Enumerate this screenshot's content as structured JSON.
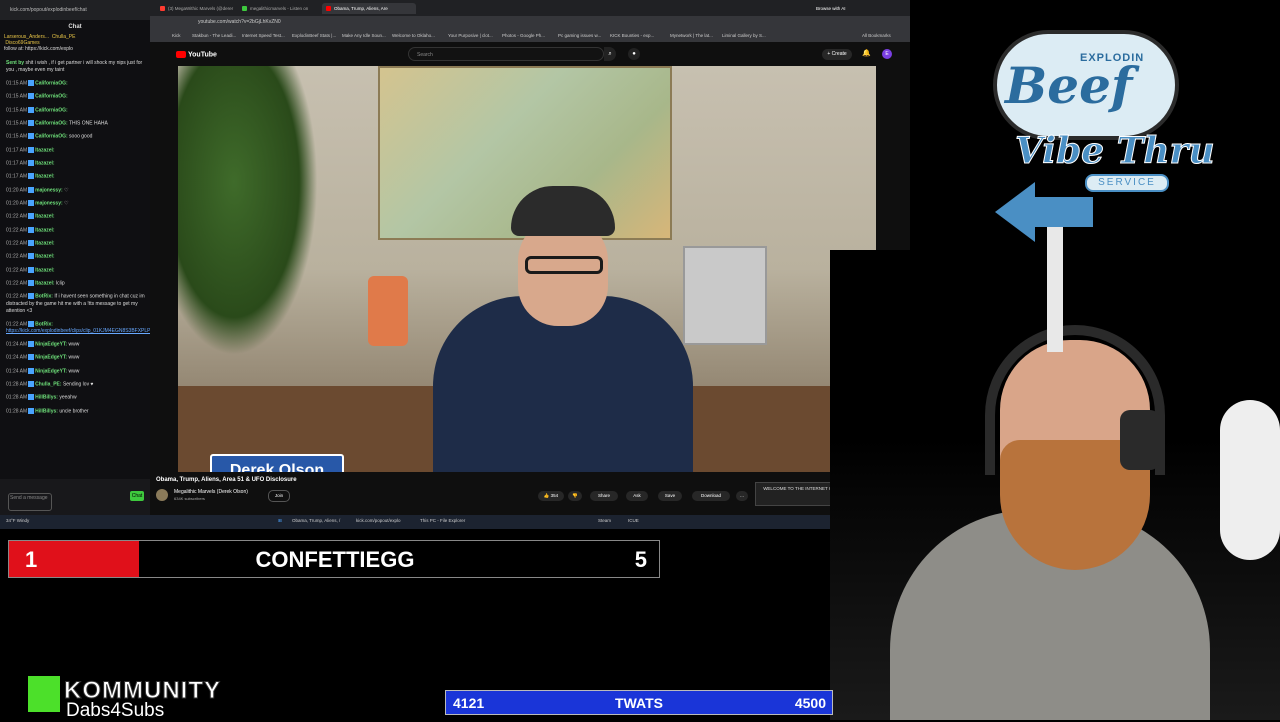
{
  "chat": {
    "url": "kick.com/popout/explodinbeef/chat",
    "title": "Chat",
    "top_users": [
      "Larserous_Anders...",
      "Chulla_PE",
      "Disco69Games"
    ],
    "pinned": "follow at: https://kick.com/explo",
    "messages": [
      {
        "time": "",
        "name": "Sent by",
        "text": "shit i wish , if i get partner i will shock my nips just for you , maybe even my taint"
      },
      {
        "time": "01:15 AM",
        "name": "CaliforniaOG:",
        "text": ""
      },
      {
        "time": "01:15 AM",
        "name": "CaliforniaOG:",
        "text": ""
      },
      {
        "time": "01:15 AM",
        "name": "CaliforniaOG:",
        "text": ""
      },
      {
        "time": "01:15 AM",
        "name": "CaliforniaOG:",
        "text": "THIS ONE HAHA"
      },
      {
        "time": "01:15 AM",
        "name": "CaliforniaOG:",
        "text": "sooo good"
      },
      {
        "time": "01:17 AM",
        "name": "Itazazel:",
        "text": ""
      },
      {
        "time": "01:17 AM",
        "name": "Itazazel:",
        "text": ""
      },
      {
        "time": "01:17 AM",
        "name": "Itazazel:",
        "text": ""
      },
      {
        "time": "01:20 AM",
        "name": "majonessy:",
        "text": "♡"
      },
      {
        "time": "01:20 AM",
        "name": "majonessy:",
        "text": "♡"
      },
      {
        "time": "01:22 AM",
        "name": "Itazazel:",
        "text": ""
      },
      {
        "time": "01:22 AM",
        "name": "Itazazel:",
        "text": ""
      },
      {
        "time": "01:22 AM",
        "name": "Itazazel:",
        "text": ""
      },
      {
        "time": "01:22 AM",
        "name": "Itazazel:",
        "text": ""
      },
      {
        "time": "01:22 AM",
        "name": "Itazazel:",
        "text": ""
      },
      {
        "time": "01:22 AM",
        "name": "Itazazel:",
        "text": "lclip"
      },
      {
        "time": "01:22 AM",
        "name": "BotRix:",
        "text": "If i havent seen something in chat cuz im distracted by the game hit me with a !tts message to get my attention <3"
      },
      {
        "time": "01:22 AM",
        "name": "BotRix:",
        "text": "",
        "link": "https://kick.com/explodinbeef/clips/clip_01KJM4EGN8S3BFXPLP6HHEW"
      },
      {
        "time": "01:24 AM",
        "name": "NinjaEdgeYT:",
        "text": "www"
      },
      {
        "time": "01:24 AM",
        "name": "NinjaEdgeYT:",
        "text": "www"
      },
      {
        "time": "01:24 AM",
        "name": "NinjaEdgeYT:",
        "text": "www"
      },
      {
        "time": "01:28 AM",
        "name": "Chulla_PE:",
        "text": "Sending lov ♥"
      },
      {
        "time": "01:28 AM",
        "name": "HillBillys:",
        "text": "yeeahw"
      },
      {
        "time": "01:28 AM",
        "name": "HillBillys:",
        "text": "uncle brother"
      }
    ],
    "send_placeholder": "Send a message",
    "chat_button": "Chat"
  },
  "browser": {
    "tabs": [
      {
        "label": "(3) MegaWithic Marvels (@derer",
        "color": "#ff3b30",
        "active": false
      },
      {
        "label": "megalithicmarvels - Listen on",
        "color": "#3ec93e",
        "active": false
      },
      {
        "label": "Obama, Trump, Aliens, Are",
        "color": "#ff0000",
        "active": true
      }
    ],
    "url": "youtube.com/watch?v=2bGjLhKvZN0",
    "bookmarks": [
      "Kick",
      "Stakbun - The Leadi...",
      "Internet Speed Test...",
      "ExplodinBeef Stats |...",
      "Make Any Idle Soun...",
      "Welcome to Oklaho...",
      "Your Purposive | clot...",
      "Photos - Google Ph...",
      "Pc gaming issues w...",
      "KICK Bounties - exp...",
      "Mynetwork | The lat...",
      "Liminal Gallery by S...",
      "All Bookmarks"
    ],
    "ai_button": "Browse with AI"
  },
  "youtube": {
    "logo": "YouTube",
    "search_placeholder": "Search",
    "create_label": "+ Create",
    "video_title": "Obama, Trump, Aliens, Area 51 & UFO Disclosure",
    "channel_name": "Megalithic Marvels (Derek Olson)",
    "subscribers": "634K subscribers",
    "join_label": "Join",
    "likes": "354",
    "share": "Share",
    "ask": "Ask",
    "save": "Save",
    "download": "Download",
    "lower_third": "Derek Olson",
    "promo_text": "WELCOME TO THE INTERNET OF GETTING THINGS DONE"
  },
  "taskbar": {
    "weather": "34°F Windy",
    "items": [
      "Obama, Trump, Aliens, /",
      "kick.com/popout/explo",
      "This PC - File Explorer",
      "Steam",
      "ICUE"
    ],
    "time": "1:30 AM",
    "date": "3/5/2026"
  },
  "overlay": {
    "confetti": {
      "left": "1",
      "label": "CONFETTIEGG",
      "right": "5",
      "progress": 0.2,
      "color": "#e0101a"
    },
    "twats": {
      "left": "4121",
      "label": "TWATS",
      "right": "4500",
      "progress": 0.916,
      "color": "#1a35d8"
    },
    "kommunity": {
      "title": "KOMMUNITY",
      "subtitle": "Dabs4Subs",
      "accent": "#4ce02a"
    }
  },
  "logo": {
    "explodin": "EXPLODIN",
    "beef": "Beef",
    "vibe": "Vibe Thru",
    "service": "SERVICE"
  }
}
